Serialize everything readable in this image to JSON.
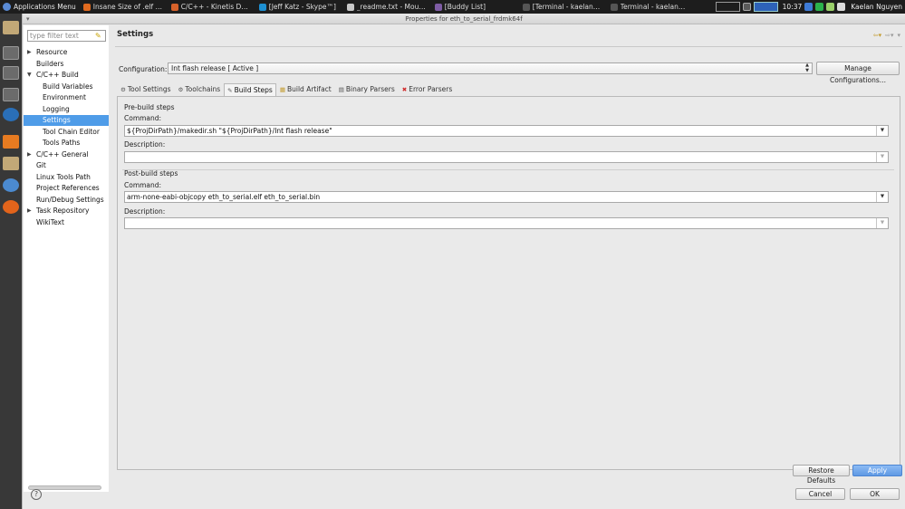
{
  "topbar": {
    "apps_menu": "Applications Menu",
    "tasks": [
      {
        "label": "Insane Size of .elf Ou...",
        "icon": "firefox-icon",
        "color": "#e06a1f"
      },
      {
        "label": "C/C++ - Kinetis Desig...",
        "icon": "eclipse-icon",
        "color": "#d7622a"
      },
      {
        "label": "[Jeff Katz - Skype™]",
        "icon": "skype-icon",
        "color": "#1d8fd1"
      },
      {
        "label": "_readme.txt - Mousep...",
        "icon": "text-editor-icon",
        "color": "#c8c8c8"
      },
      {
        "label": "[Buddy List]",
        "icon": "pidgin-icon",
        "color": "#7e5ca4"
      },
      {
        "label": "[Terminal - kaelan@k...",
        "icon": "terminal-icon",
        "color": "#555555"
      },
      {
        "label": "Terminal - kaelan@ka...",
        "icon": "terminal-icon",
        "color": "#555555"
      }
    ],
    "clock": "10:37",
    "user": "Kaelan Nguyen",
    "tray_colors": [
      "#3e7bd6",
      "#2bb24c",
      "#9ad06a",
      "#dddddd",
      "#bbbbbb"
    ]
  },
  "dialog": {
    "title": "Properties for eth_to_serial_frdmk64f",
    "filter_placeholder": "type filter text",
    "tree": [
      {
        "label": "Resource",
        "indent": 1,
        "expander": "▶"
      },
      {
        "label": "Builders",
        "indent": 1,
        "expander": ""
      },
      {
        "label": "C/C++ Build",
        "indent": 1,
        "expander": "▼"
      },
      {
        "label": "Build Variables",
        "indent": 2,
        "expander": ""
      },
      {
        "label": "Environment",
        "indent": 2,
        "expander": ""
      },
      {
        "label": "Logging",
        "indent": 2,
        "expander": ""
      },
      {
        "label": "Settings",
        "indent": 2,
        "expander": "",
        "selected": true
      },
      {
        "label": "Tool Chain Editor",
        "indent": 2,
        "expander": ""
      },
      {
        "label": "Tools Paths",
        "indent": 2,
        "expander": ""
      },
      {
        "label": "C/C++ General",
        "indent": 1,
        "expander": "▶"
      },
      {
        "label": "Git",
        "indent": 1,
        "expander": ""
      },
      {
        "label": "Linux Tools Path",
        "indent": 1,
        "expander": ""
      },
      {
        "label": "Project References",
        "indent": 1,
        "expander": ""
      },
      {
        "label": "Run/Debug Settings",
        "indent": 1,
        "expander": ""
      },
      {
        "label": "Task Repository",
        "indent": 1,
        "expander": "▶"
      },
      {
        "label": "WikiText",
        "indent": 1,
        "expander": ""
      }
    ],
    "heading": "Settings",
    "configuration_label": "Configuration:",
    "configuration_value": "Int flash release  [ Active ]",
    "manage_button": "Manage Configurations...",
    "tabs": [
      {
        "label": "Tool Settings",
        "icon": "tool-settings-icon",
        "glyph": "⚙",
        "active": false
      },
      {
        "label": "Toolchains",
        "icon": "toolchains-icon",
        "glyph": "⚙",
        "active": false
      },
      {
        "label": "Build Steps",
        "icon": "build-steps-icon",
        "glyph": "✎",
        "active": true
      },
      {
        "label": "Build Artifact",
        "icon": "build-artifact-icon",
        "glyph": "▦",
        "active": false
      },
      {
        "label": "Binary Parsers",
        "icon": "binary-parsers-icon",
        "glyph": "▤",
        "active": false
      },
      {
        "label": "Error Parsers",
        "icon": "error-parsers-icon",
        "glyph": "✖",
        "active": false
      }
    ],
    "prebuild": {
      "title": "Pre-build steps",
      "command_label": "Command:",
      "command_value": "${ProjDirPath}/makedir.sh \"${ProjDirPath}/Int flash release\"",
      "description_label": "Description:",
      "description_value": ""
    },
    "postbuild": {
      "title": "Post-build steps",
      "command_label": "Command:",
      "command_value": "arm-none-eabi-objcopy eth_to_serial.elf eth_to_serial.bin",
      "description_label": "Description:",
      "description_value": ""
    },
    "restore_defaults": "Restore Defaults",
    "apply": "Apply",
    "cancel": "Cancel",
    "ok": "OK",
    "help": "?"
  }
}
